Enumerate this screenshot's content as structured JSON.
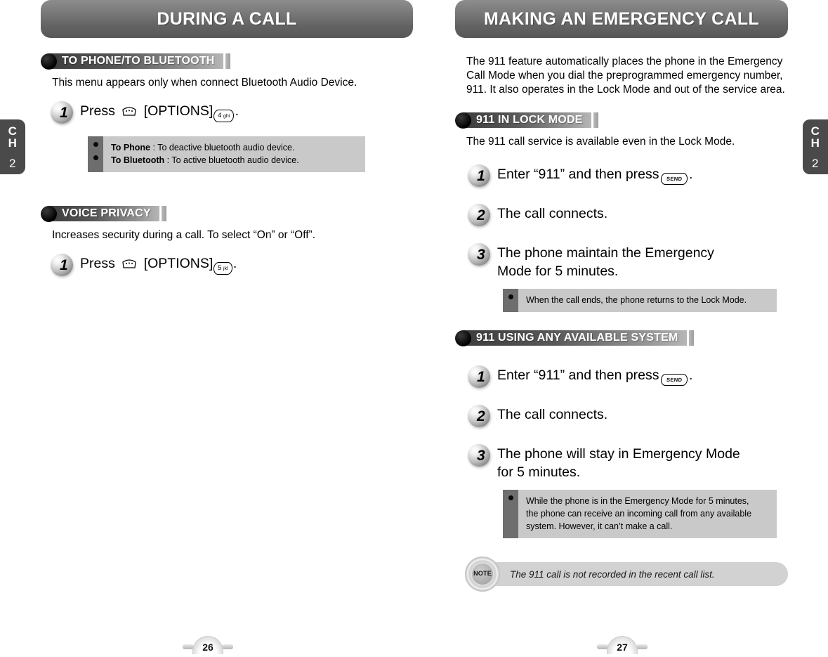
{
  "chapter_tab": {
    "c": "C",
    "h": "H",
    "number": "2"
  },
  "left_page": {
    "title": "DURING A CALL",
    "page_number": "26",
    "sections": [
      {
        "heading": "TO PHONE/TO BLUETOOTH",
        "body": "This menu appears only when connect Bluetooth Audio Device.",
        "step": {
          "number": "1",
          "prefix": "Press",
          "softkey_icon": "options-softkey-icon",
          "label": "[OPTIONS]",
          "key_digit": "4",
          "key_letters": "ghi",
          "suffix": "."
        },
        "info_box": [
          {
            "term": "To Phone",
            "desc": " : To deactive bluetooth audio device."
          },
          {
            "term": "To Bluetooth",
            "desc": " : To active bluetooth audio device."
          }
        ]
      },
      {
        "heading": "VOICE PRIVACY",
        "body": "Increases security during a call. To select “On” or “Off”.",
        "step": {
          "number": "1",
          "prefix": "Press",
          "softkey_icon": "options-softkey-icon",
          "label": "[OPTIONS]",
          "key_digit": "5",
          "key_letters": "jkl",
          "suffix": "."
        }
      }
    ]
  },
  "right_page": {
    "title": "MAKING AN EMERGENCY CALL",
    "page_number": "27",
    "intro": "The 911 feature automatically places the phone in the Emergency Call Mode when you dial the preprogrammed emergency number, 911. It also operates in the Lock Mode and out of the service area.",
    "section_lock": {
      "heading": "911 IN LOCK MODE",
      "body": "The 911 call service is available even in the Lock Mode.",
      "steps": [
        {
          "number": "1",
          "text_before": "Enter “911” and then press",
          "send_key": "SEND",
          "text_after": "."
        },
        {
          "number": "2",
          "text_before": "The call connects.",
          "send_key": "",
          "text_after": ""
        },
        {
          "number": "3",
          "text_before": "The phone maintain the Emergency Mode for 5 minutes.",
          "send_key": "",
          "text_after": ""
        }
      ],
      "info_text": "When the call ends, the phone returns to the Lock Mode."
    },
    "section_any": {
      "heading": "911 USING ANY AVAILABLE SYSTEM",
      "steps": [
        {
          "number": "1",
          "text_before": "Enter “911” and then press",
          "send_key": "SEND",
          "text_after": "."
        },
        {
          "number": "2",
          "text_before": "The call connects.",
          "send_key": "",
          "text_after": ""
        },
        {
          "number": "3",
          "text_before": "The phone will stay in Emergency Mode for 5 minutes.",
          "send_key": "",
          "text_after": ""
        }
      ],
      "info_lines": [
        "While the phone is in the Emergency Mode for 5 minutes,",
        "the phone can receive an incoming call from any available",
        "system. However, it can’t make a call."
      ]
    },
    "note": {
      "badge_label": "NOTE",
      "text": "The 911 call is not recorded in the recent call list."
    }
  }
}
